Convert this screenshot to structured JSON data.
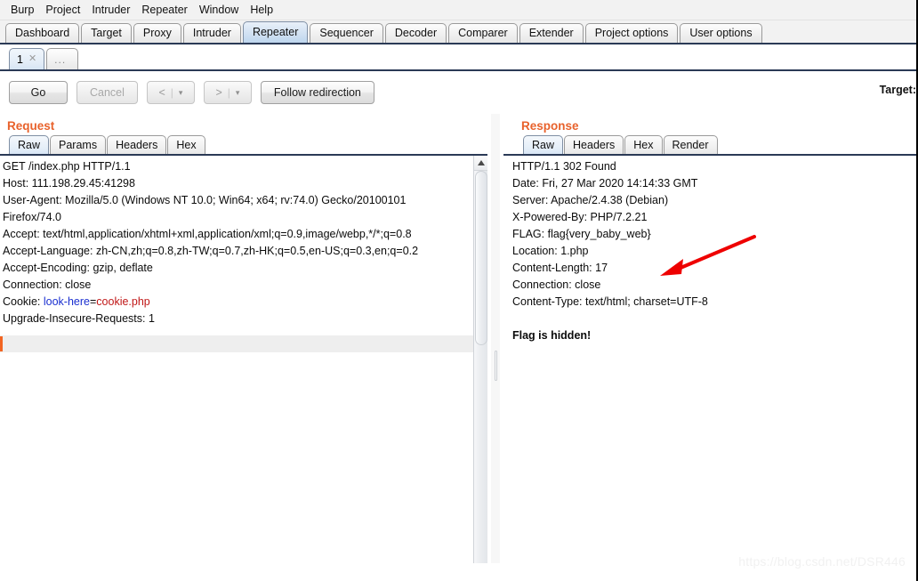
{
  "app": {
    "name": "Burp Suite Repeater"
  },
  "menubar": {
    "items": [
      {
        "label": "Burp"
      },
      {
        "label": "Project"
      },
      {
        "label": "Intruder"
      },
      {
        "label": "Repeater"
      },
      {
        "label": "Window"
      },
      {
        "label": "Help"
      }
    ]
  },
  "main_tabs": {
    "selected": "Repeater",
    "items": [
      {
        "label": "Dashboard"
      },
      {
        "label": "Target"
      },
      {
        "label": "Proxy"
      },
      {
        "label": "Intruder"
      },
      {
        "label": "Repeater"
      },
      {
        "label": "Sequencer"
      },
      {
        "label": "Decoder"
      },
      {
        "label": "Comparer"
      },
      {
        "label": "Extender"
      },
      {
        "label": "Project options"
      },
      {
        "label": "User options"
      }
    ]
  },
  "sub_tabs": {
    "selected": "1",
    "items": [
      {
        "label": "1",
        "close_icon": "close-x"
      },
      {
        "label": "...",
        "close_icon": ""
      }
    ]
  },
  "toolbar": {
    "go_label": "Go",
    "cancel_label": "Cancel",
    "back_label": "<",
    "back_caret": "▾",
    "forward_label": ">",
    "forward_caret": "▾",
    "separator": "|",
    "follow_redirection_label": "Follow redirection",
    "target_label": "Target:"
  },
  "request": {
    "title": "Request",
    "tabs": [
      {
        "label": "Raw"
      },
      {
        "label": "Params"
      },
      {
        "label": "Headers"
      },
      {
        "label": "Hex"
      }
    ],
    "selected_tab": "Raw",
    "lines": [
      {
        "text": "GET /index.php HTTP/1.1"
      },
      {
        "text": "Host: 111.198.29.45:41298"
      },
      {
        "text": "User-Agent: Mozilla/5.0 (Windows NT 10.0; Win64; x64; rv:74.0) Gecko/20100101"
      },
      {
        "text": "Firefox/74.0"
      },
      {
        "text": "Accept: text/html,application/xhtml+xml,application/xml;q=0.9,image/webp,*/*;q=0.8"
      },
      {
        "text": "Accept-Language: zh-CN,zh;q=0.8,zh-TW;q=0.7,zh-HK;q=0.5,en-US;q=0.3,en;q=0.2"
      },
      {
        "text": "Accept-Encoding: gzip, deflate"
      },
      {
        "text": "Connection: close"
      },
      {
        "text": "",
        "is_cookie": true
      },
      {
        "text": "Upgrade-Insecure-Requests: 1"
      }
    ],
    "cookie_line": {
      "prefix": "Cookie: ",
      "name": "look-here",
      "equals": "=",
      "value": "cookie.php"
    }
  },
  "response": {
    "title": "Response",
    "tabs": [
      {
        "label": "Raw"
      },
      {
        "label": "Headers"
      },
      {
        "label": "Hex"
      },
      {
        "label": "Render"
      }
    ],
    "selected_tab": "Raw",
    "lines": [
      {
        "text": "HTTP/1.1 302 Found",
        "bold": false
      },
      {
        "text": "Date: Fri, 27 Mar 2020 14:14:33 GMT",
        "bold": false
      },
      {
        "text": "Server: Apache/2.4.38 (Debian)",
        "bold": false
      },
      {
        "text": "X-Powered-By: PHP/7.2.21",
        "bold": false
      },
      {
        "text": "FLAG: flag{very_baby_web}",
        "bold": false
      },
      {
        "text": "Location: 1.php",
        "bold": false
      },
      {
        "text": "Content-Length: 17",
        "bold": false
      },
      {
        "text": "Connection: close",
        "bold": false
      },
      {
        "text": "Content-Type: text/html; charset=UTF-8",
        "bold": false
      },
      {
        "text": "",
        "bold": false
      },
      {
        "text": "Flag is hidden!",
        "bold": true
      }
    ]
  },
  "annotation": {
    "arrow_color": "#ee0000",
    "points_to": "FLAG: flag{very_baby_web}"
  },
  "watermark": {
    "text": "https://blog.csdn.net/DSR446"
  },
  "colors": {
    "pane_title": "#e8622c",
    "tab_selected": "#cfe0f2",
    "cookie_name": "#1a2fd0",
    "cookie_value": "#c01818",
    "caret": "#f26522"
  }
}
